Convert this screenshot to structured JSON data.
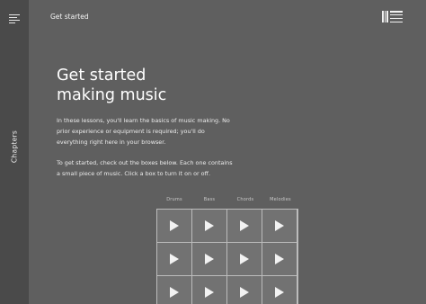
{
  "rail": {
    "chapters_label": "Chapters"
  },
  "header": {
    "title": "Get started"
  },
  "main": {
    "headline_line1": "Get started",
    "headline_line2": "making music",
    "paragraph1": "In these lessons, you'll learn the basics of music making. No prior experience or equipment is required; you'll do everything right here in your browser.",
    "paragraph2": "To get started, check out the boxes below. Each one contains a small piece of music. Click a box to turn it on or off."
  },
  "grid": {
    "columns": [
      "Drums",
      "Bass",
      "Chords",
      "Melodies"
    ]
  },
  "colors": {
    "background": "#5f5f5f",
    "rail": "#4a4a4a",
    "cell": "#727272",
    "grid_lines": "#bcbcbc",
    "text": "#ffffff"
  }
}
